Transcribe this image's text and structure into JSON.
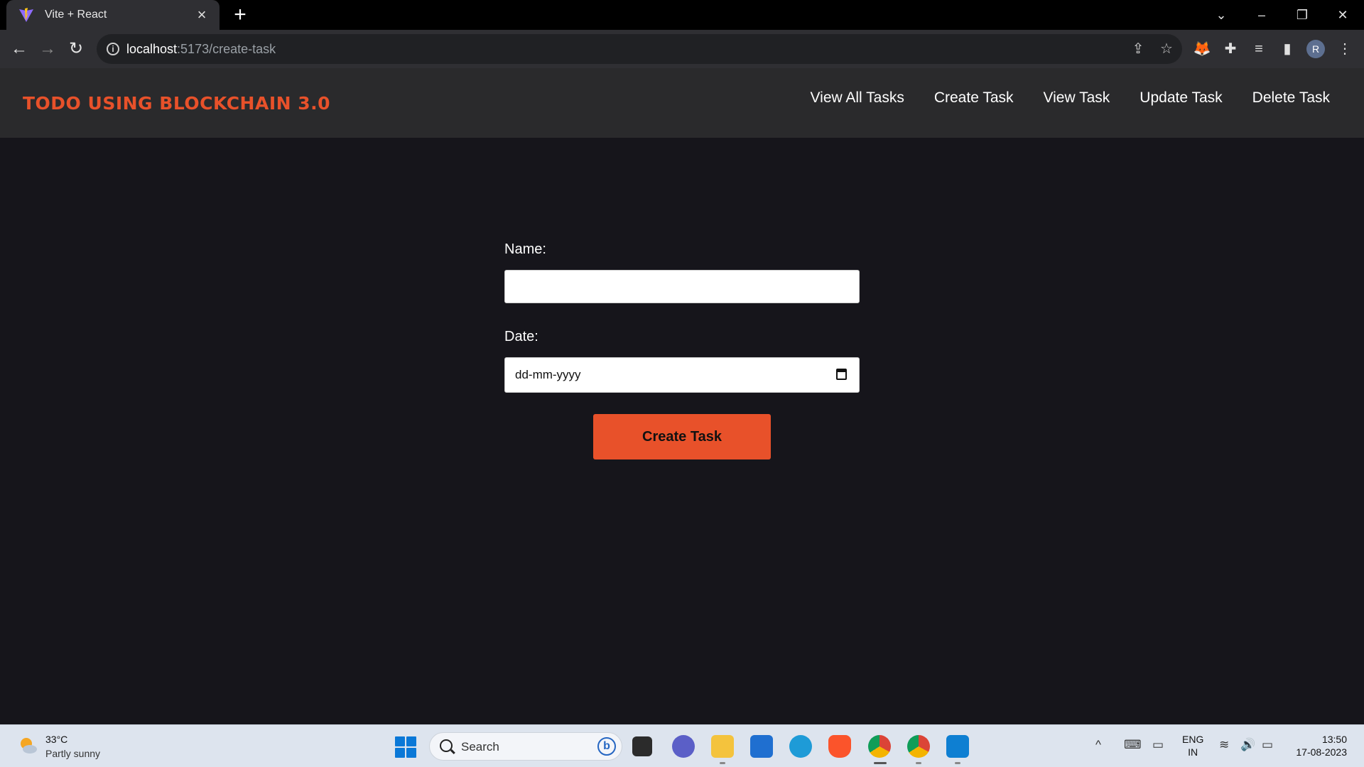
{
  "browser": {
    "tab_title": "Vite + React",
    "url_host": "localhost",
    "url_path": ":5173/create-task"
  },
  "app": {
    "brand": "TODO USING BLOCKCHAIN 3.0",
    "nav": [
      "View All Tasks",
      "Create Task",
      "View Task",
      "Update Task",
      "Delete Task"
    ],
    "accent_color": "#e8512a"
  },
  "form": {
    "name_label": "Name:",
    "name_value": "",
    "date_label": "Date:",
    "date_placeholder": "dd-mm-yyyy",
    "submit_label": "Create Task"
  },
  "taskbar": {
    "temperature": "33°C",
    "condition": "Partly sunny",
    "search_placeholder": "Search",
    "language_line1": "ENG",
    "language_line2": "IN",
    "time": "13:50",
    "date": "17-08-2023"
  }
}
